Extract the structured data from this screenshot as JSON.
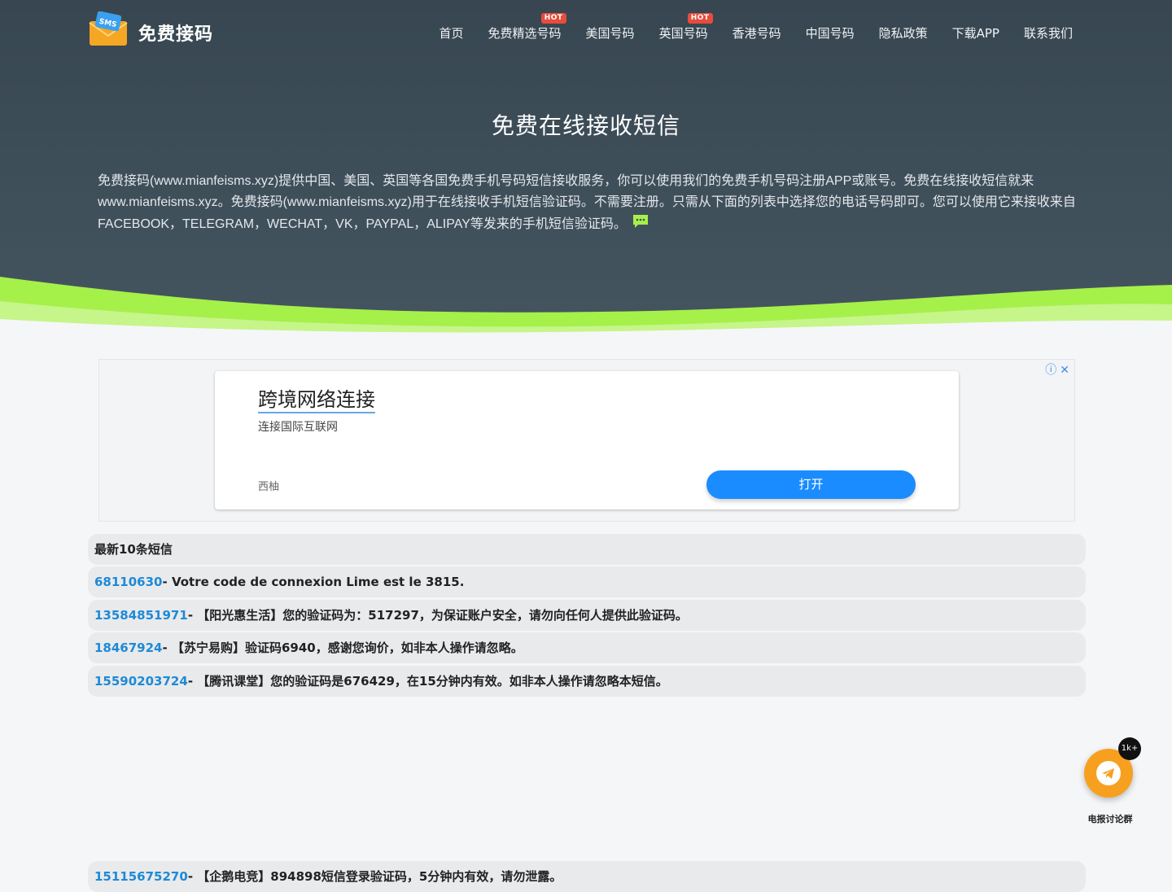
{
  "brand": {
    "name": "免费接码",
    "logo_text": "SMS"
  },
  "nav": {
    "items": [
      {
        "label": "首页"
      },
      {
        "label": "免费精选号码",
        "badge": "HOT"
      },
      {
        "label": "美国号码"
      },
      {
        "label": "英国号码",
        "badge": "HOT"
      },
      {
        "label": "香港号码"
      },
      {
        "label": "中国号码"
      },
      {
        "label": "隐私政策"
      },
      {
        "label": "下载APP"
      },
      {
        "label": "联系我们"
      }
    ]
  },
  "hero": {
    "title": "免费在线接收短信",
    "description": "免费接码(www.mianfeisms.xyz)提供中国、美国、英国等各国免费手机号码短信接收服务，你可以使用我们的免费手机号码注册APP或账号。免费在线接收短信就来www.mianfeisms.xyz。免费接码(www.mianfeisms.xyz)用于在线接收手机短信验证码。不需要注册。只需从下面的列表中选择您的电话号码即可。您可以使用它来接收来自FACEBOOK，TELEGRAM，WECHAT，VK，PAYPAL，ALIPAY等发来的手机短信验证码。"
  },
  "ad": {
    "title": "跨境网络连接",
    "subtitle": "连接国际互联网",
    "source": "西柚",
    "button": "打开",
    "info_icon": "ⓘ",
    "close_icon": "✕"
  },
  "messages": {
    "header": "最新10条短信",
    "rows": [
      {
        "number": "68110630",
        "text": "- Votre code de connexion Lime est le 3815."
      },
      {
        "number": "13584851971",
        "text": "- 【阳光惠生活】您的验证码为：517297，为保证账户安全，请勿向任何人提供此验证码。"
      },
      {
        "number": "18467924",
        "text": "- 【苏宁易购】验证码6940，感谢您询价，如非本人操作请忽略。"
      },
      {
        "number": "15590203724",
        "text": "- 【腾讯课堂】您的验证码是676429，在15分钟内有效。如非本人操作请忽略本短信。"
      },
      {
        "number": "15115675270",
        "text": "- 【企鹅电竞】894898短信登录验证码，5分钟内有效，请勿泄露。"
      }
    ]
  },
  "telegram": {
    "badge": "1k+",
    "label": "电报讨论群"
  },
  "colors": {
    "accent_green": "#a6f04a",
    "link_blue": "#1e8ad6",
    "hot_red": "#e74c3c",
    "tg_orange": "#f7a01f"
  }
}
